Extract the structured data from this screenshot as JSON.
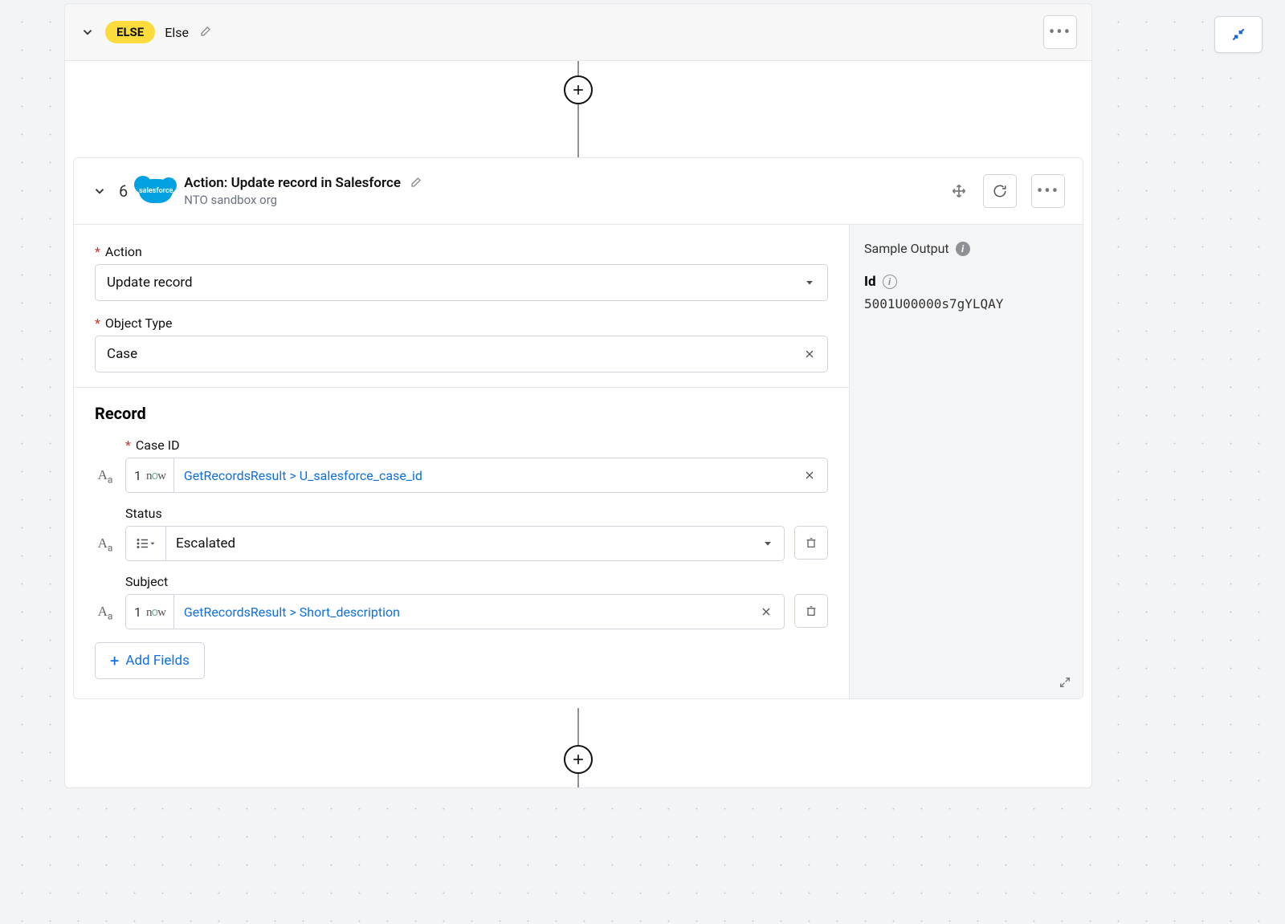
{
  "else_block": {
    "badge": "ELSE",
    "label": "Else"
  },
  "action": {
    "step": "6",
    "title": "Action: Update record in Salesforce",
    "subtitle": "NTO sandbox org",
    "fields": {
      "action_label": "Action",
      "action_value": "Update record",
      "object_type_label": "Object Type",
      "object_type_value": "Case"
    },
    "record": {
      "heading": "Record",
      "items": [
        {
          "label": "Case ID",
          "required": true,
          "prefix_num": "1",
          "value": "GetRecordsResult > U_salesforce_case_id",
          "type": "pill"
        },
        {
          "label": "Status",
          "required": false,
          "value": "Escalated",
          "type": "select"
        },
        {
          "label": "Subject",
          "required": false,
          "prefix_num": "1",
          "value": "GetRecordsResult > Short_description",
          "type": "pill"
        }
      ],
      "add_button": "Add Fields"
    }
  },
  "sample_output": {
    "title": "Sample Output",
    "id_label": "Id",
    "id_value": "5001U00000s7gYLQAY"
  }
}
